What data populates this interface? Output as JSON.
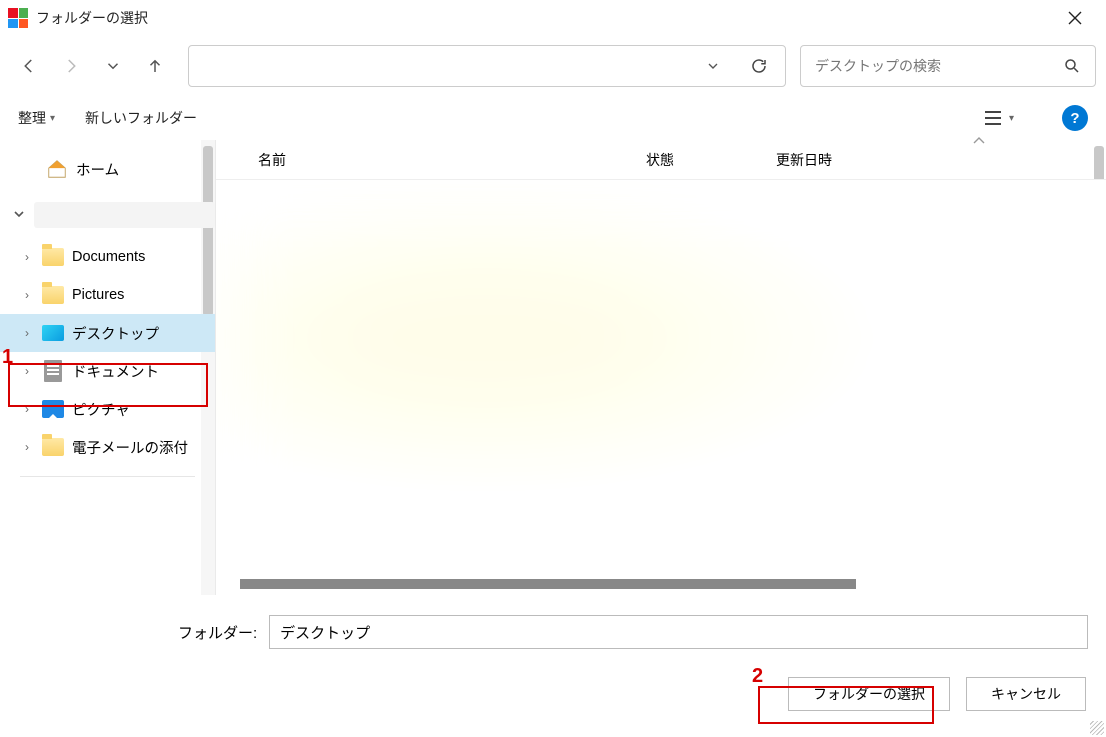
{
  "title": "フォルダーの選択",
  "nav": {},
  "search": {
    "placeholder": "デスクトップの検索"
  },
  "toolbar": {
    "organize": "整理",
    "new_folder": "新しいフォルダー"
  },
  "sidebar": {
    "home": "ホーム",
    "user": "",
    "documents": "Documents",
    "pictures": "Pictures",
    "desktop": "デスクトップ",
    "docs_jp": "ドキュメント",
    "pics_jp": "ピクチャ",
    "mail": "電子メールの添付"
  },
  "columns": {
    "name": "名前",
    "status": "状態",
    "date": "更新日時"
  },
  "bottom": {
    "label": "フォルダー:",
    "value": "デスクトップ",
    "select": "フォルダーの選択",
    "cancel": "キャンセル"
  },
  "annot": {
    "n1": "1",
    "n2": "2"
  }
}
